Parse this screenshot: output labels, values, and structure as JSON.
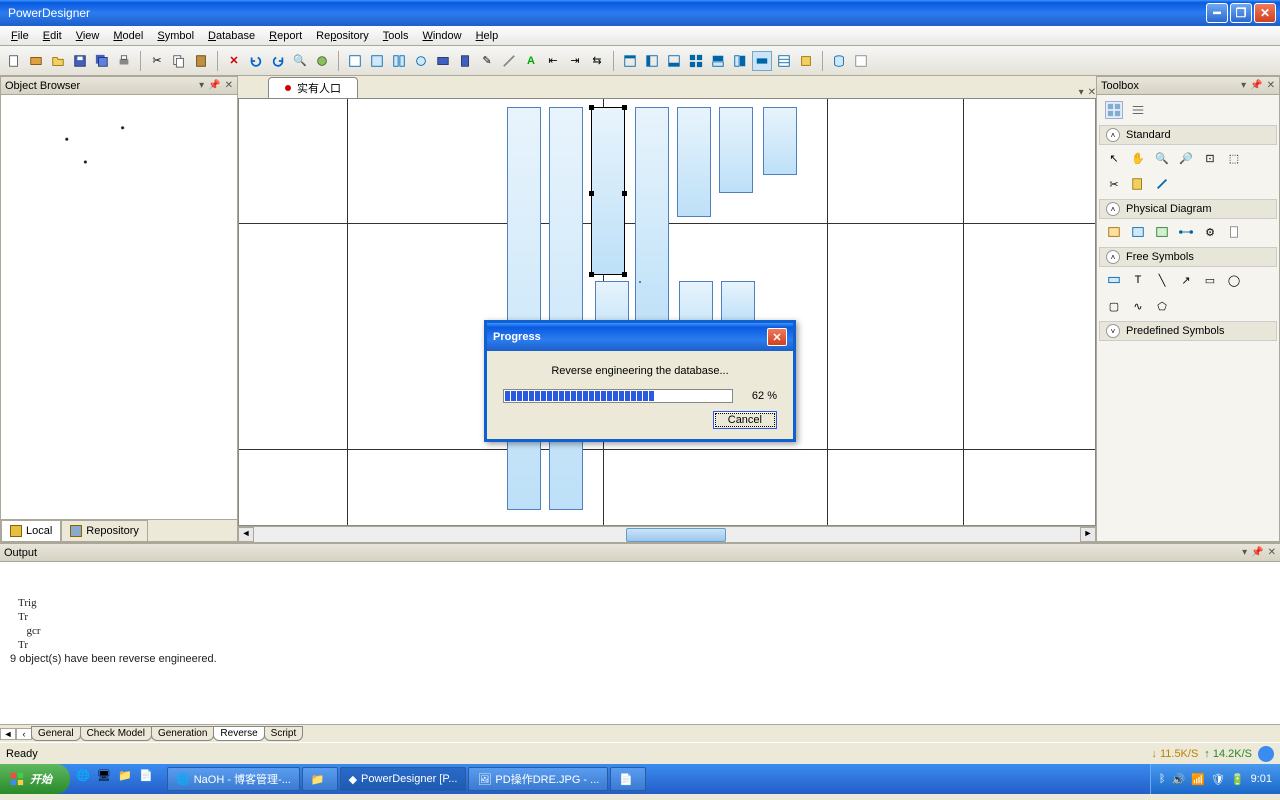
{
  "window": {
    "title": "PowerDesigner"
  },
  "menu": [
    "File",
    "Edit",
    "View",
    "Model",
    "Symbol",
    "Database",
    "Report",
    "Repository",
    "Tools",
    "Window",
    "Help"
  ],
  "panels": {
    "browser": {
      "title": "Object Browser",
      "tabs": [
        "Local",
        "Repository"
      ]
    },
    "toolbox": {
      "title": "Toolbox",
      "sections": [
        "Standard",
        "Physical Diagram",
        "Free Symbols",
        "Predefined Symbols"
      ]
    },
    "output": {
      "title": "Output",
      "message": "9 object(s) have been reverse engineered.",
      "tabs": [
        "General",
        "Check Model",
        "Generation",
        "Reverse",
        "Script"
      ]
    }
  },
  "diagram": {
    "tab_label": "实有人口"
  },
  "dialog": {
    "title": "Progress",
    "message": "Reverse engineering the database...",
    "percent_label": "62 %",
    "percent": 62,
    "cancel": "Cancel"
  },
  "status": {
    "text": "Ready",
    "down": "↓ 11.5K/S",
    "up": "↑ 14.2K/S"
  },
  "taskbar": {
    "start": "开始",
    "items": [
      "NaOH - 博客管理-...",
      "",
      "PowerDesigner [P...",
      "PD操作DRE.JPG - ...",
      ""
    ],
    "clock": "9:01"
  }
}
